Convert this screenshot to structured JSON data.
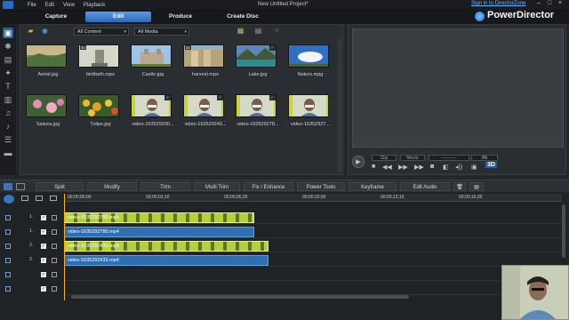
{
  "menu": {
    "items": [
      "File",
      "Edit",
      "View",
      "Playback"
    ],
    "title": "New Untitled Project*",
    "signin": "Sign in to DirectorZone",
    "minimize": "–",
    "maximize": "□",
    "close": "×"
  },
  "tabs": [
    "Capture",
    "Edit",
    "Produce",
    "Create Disc"
  ],
  "brand": "PowerDirector",
  "library": {
    "filter1": "All Content",
    "filter2": "All Media",
    "badge_3d": "3D",
    "clips": [
      {
        "name": "Aerial.jpg",
        "thumb": "landscape",
        "check": false,
        "badge": false
      },
      {
        "name": "birdbath.mpo",
        "thumb": "statue",
        "check": false,
        "badge": true
      },
      {
        "name": "Castle.jpg",
        "thumb": "castle",
        "check": false,
        "badge": false
      },
      {
        "name": "harvest.mpo",
        "thumb": "harvest",
        "check": false,
        "badge": true
      },
      {
        "name": "Lake.jpg",
        "thumb": "lake",
        "check": true,
        "badge": false
      },
      {
        "name": "Nature.mpg",
        "thumb": "sky",
        "check": false,
        "badge": false
      },
      {
        "name": "Sakura.jpg",
        "thumb": "sakura",
        "check": false,
        "badge": false
      },
      {
        "name": "Tulips.jpg",
        "thumb": "tulips",
        "check": false,
        "badge": false
      },
      {
        "name": "video-163529200...",
        "thumb": "person",
        "check": true,
        "badge": false
      },
      {
        "name": "video-163529243...",
        "thumb": "person",
        "check": true,
        "badge": false
      },
      {
        "name": "video-163529278...",
        "thumb": "person",
        "check": true,
        "badge": false
      },
      {
        "name": "video-16352927...",
        "thumb": "person",
        "check": false,
        "badge": false
      }
    ]
  },
  "preview": {
    "clip_label": "Clip",
    "movie_label": "Movie",
    "timecode": "--:--:--:--",
    "fit": "Fit",
    "mode_3d": "3D"
  },
  "toolbar": [
    "Split",
    "Modify",
    "Trim",
    "Multi Trim",
    "Fix / Enhance",
    "Power Tools",
    "Keyframe",
    "Edit Audio"
  ],
  "timeline": {
    "ticks": [
      "00;00;00;00",
      "00;00;03;10",
      "00;00;06;20",
      "00;00;10;00",
      "00;00;13;10",
      "00;00;16;20"
    ],
    "tracks": [
      {
        "num": "1.",
        "type": "video"
      },
      {
        "num": "1.",
        "type": "audio"
      },
      {
        "num": "2.",
        "type": "video"
      },
      {
        "num": "2.",
        "type": "audio"
      },
      {
        "num": "",
        "type": "fx"
      },
      {
        "num": "",
        "type": "title"
      }
    ],
    "clips": [
      {
        "track": 0,
        "label": "video-1635292780.mp4",
        "kind": "video"
      },
      {
        "track": 1,
        "label": "video-1635292780.mp4",
        "kind": "audio"
      },
      {
        "track": 2,
        "label": "video-1635292433.mp4",
        "kind": "video"
      },
      {
        "track": 3,
        "label": "video-1635292433.mp4",
        "kind": "audio"
      }
    ]
  },
  "colors": {
    "accent": "#2d67b5",
    "clip_video": "#b6cf3a",
    "clip_audio": "#2d6fb0",
    "playhead": "#ffb400"
  }
}
